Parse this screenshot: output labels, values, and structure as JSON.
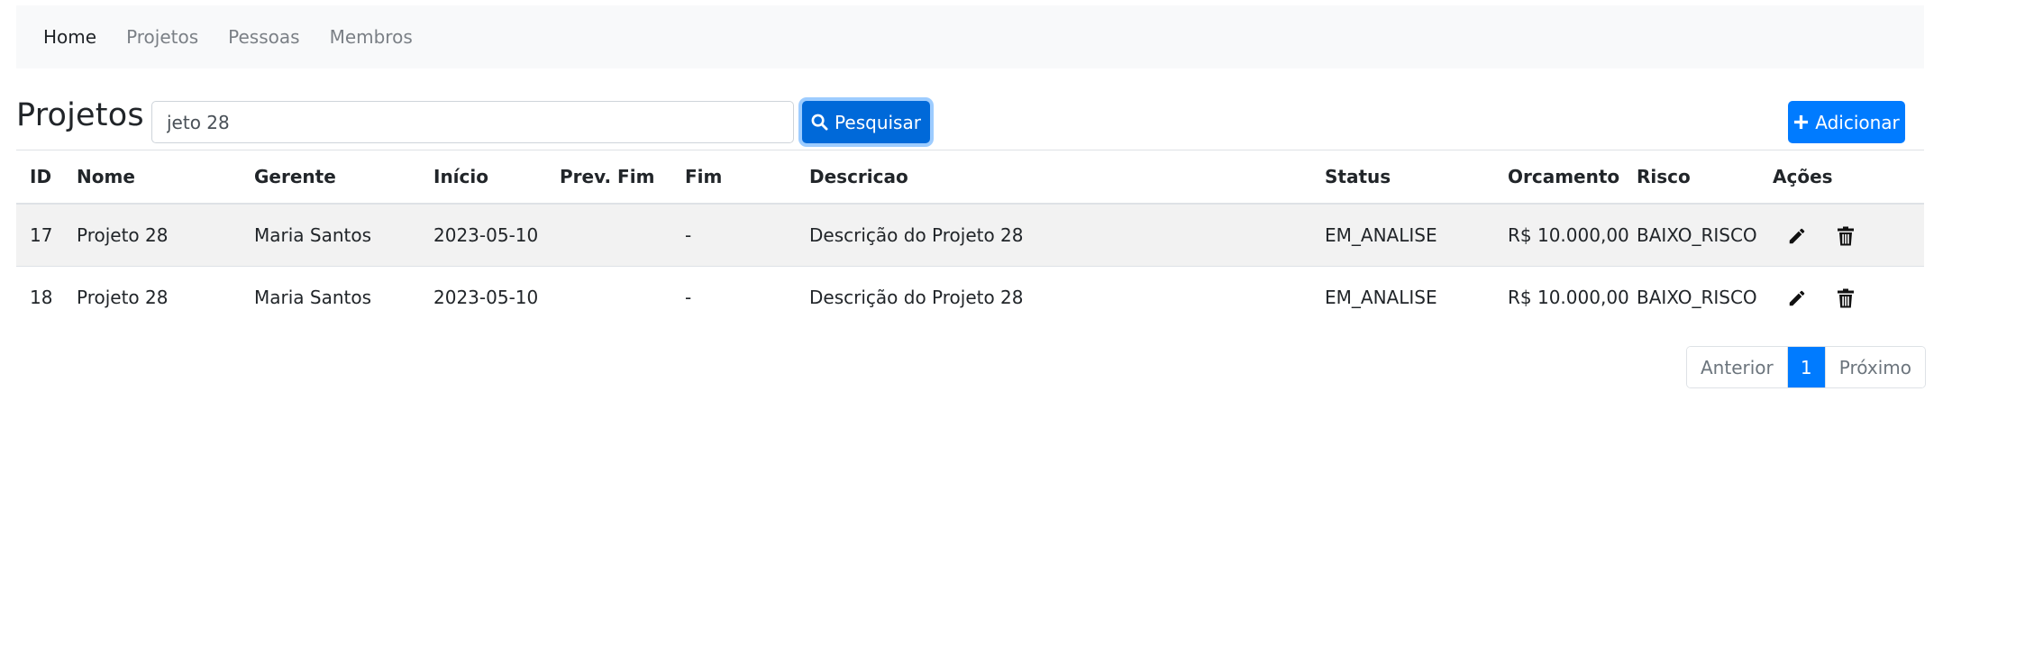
{
  "nav": {
    "items": [
      {
        "label": "Home",
        "active": true
      },
      {
        "label": "Projetos",
        "active": false
      },
      {
        "label": "Pessoas",
        "active": false
      },
      {
        "label": "Membros",
        "active": false
      }
    ]
  },
  "header": {
    "title": "Projetos",
    "search_value": "jeto 28",
    "search_button": "Pesquisar",
    "add_button": "Adicionar"
  },
  "table": {
    "columns": [
      "ID",
      "Nome",
      "Gerente",
      "Início",
      "Prev. Fim",
      "Fim",
      "Descricao",
      "Status",
      "Orcamento",
      "Risco",
      "Ações"
    ],
    "rows": [
      {
        "id": "17",
        "nome": "Projeto 28",
        "gerente": "Maria Santos",
        "inicio": "2023-05-10",
        "prev_fim": "",
        "fim": "-",
        "descricao": "Descrição do Projeto 28",
        "status": "EM_ANALISE",
        "orcamento": "R$ 10.000,00",
        "risco": "BAIXO_RISCO"
      },
      {
        "id": "18",
        "nome": "Projeto 28",
        "gerente": "Maria Santos",
        "inicio": "2023-05-10",
        "prev_fim": "",
        "fim": "-",
        "descricao": "Descrição do Projeto 28",
        "status": "EM_ANALISE",
        "orcamento": "R$ 10.000,00",
        "risco": "BAIXO_RISCO"
      }
    ]
  },
  "pagination": {
    "previous": "Anterior",
    "current": "1",
    "next": "Próximo"
  },
  "icons": {
    "search": "search-icon",
    "add": "plus-icon",
    "edit": "pencil-icon",
    "delete": "trash-icon"
  },
  "colors": {
    "primary": "#007bff",
    "navbar_bg": "#f8f9fa",
    "stripe": "#f2f2f2"
  }
}
